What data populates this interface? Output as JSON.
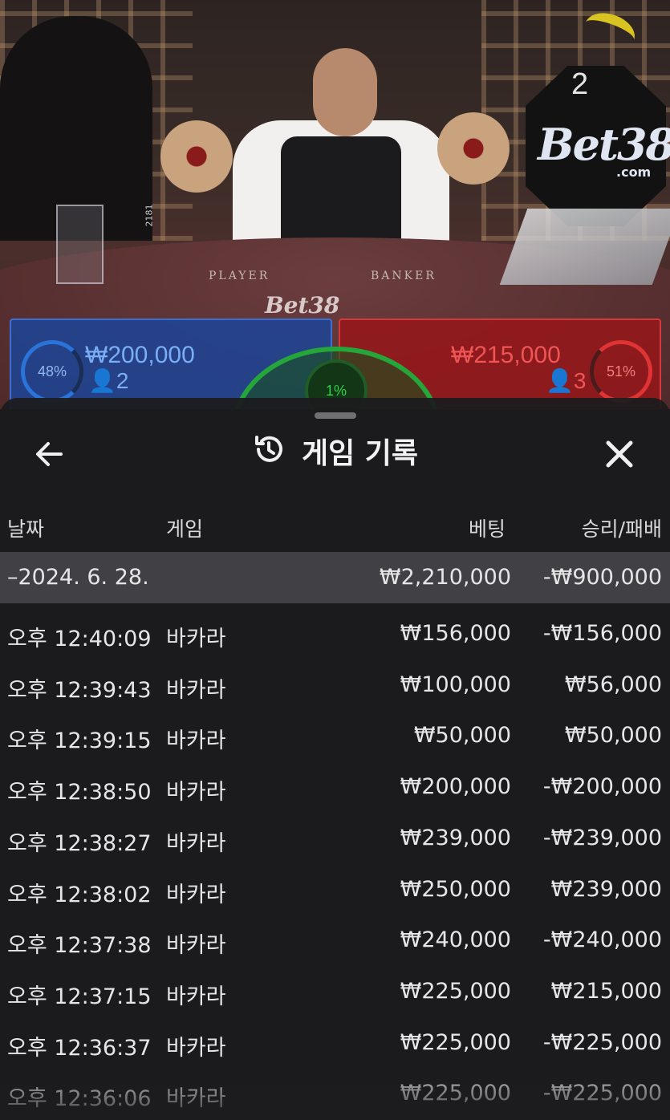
{
  "video": {
    "round_number": "2",
    "brand_logo": "Bet38",
    "brand_suffix": ".com",
    "felt_player": "PLAYER",
    "felt_banker": "BANKER",
    "shoe_label": "2181",
    "player": {
      "percent": "48%",
      "amount": "₩200,000",
      "count": "2",
      "color": "#2a73d9"
    },
    "banker": {
      "percent": "51%",
      "amount": "₩215,000",
      "count": "3",
      "color": "#e03434"
    },
    "tie": {
      "percent": "1%",
      "color": "#25a63a"
    }
  },
  "sheet": {
    "title": "게임 기록",
    "back_icon": "arrow-left-icon",
    "history_icon": "history-icon",
    "close_icon": "close-icon",
    "columns": {
      "date": "날짜",
      "game": "게임",
      "bet": "베팅",
      "result": "승리/패배"
    },
    "day_summary": {
      "date": "–2024. 6. 28.",
      "bet": "₩2,210,000",
      "result": "-₩900,000"
    },
    "rows": [
      {
        "time": "오후 12:40:09",
        "game": "바카라",
        "bet": "₩156,000",
        "result": "-₩156,000"
      },
      {
        "time": "오후 12:39:43",
        "game": "바카라",
        "bet": "₩100,000",
        "result": "₩56,000"
      },
      {
        "time": "오후 12:39:15",
        "game": "바카라",
        "bet": "₩50,000",
        "result": "₩50,000"
      },
      {
        "time": "오후 12:38:50",
        "game": "바카라",
        "bet": "₩200,000",
        "result": "-₩200,000"
      },
      {
        "time": "오후 12:38:27",
        "game": "바카라",
        "bet": "₩239,000",
        "result": "-₩239,000"
      },
      {
        "time": "오후 12:38:02",
        "game": "바카라",
        "bet": "₩250,000",
        "result": "₩239,000"
      },
      {
        "time": "오후 12:37:38",
        "game": "바카라",
        "bet": "₩240,000",
        "result": "-₩240,000"
      },
      {
        "time": "오후 12:37:15",
        "game": "바카라",
        "bet": "₩225,000",
        "result": "₩215,000"
      },
      {
        "time": "오후 12:36:37",
        "game": "바카라",
        "bet": "₩225,000",
        "result": "-₩225,000"
      },
      {
        "time": "오후 12:36:06",
        "game": "바카라",
        "bet": "₩225,000",
        "result": "-₩225,000"
      }
    ]
  }
}
